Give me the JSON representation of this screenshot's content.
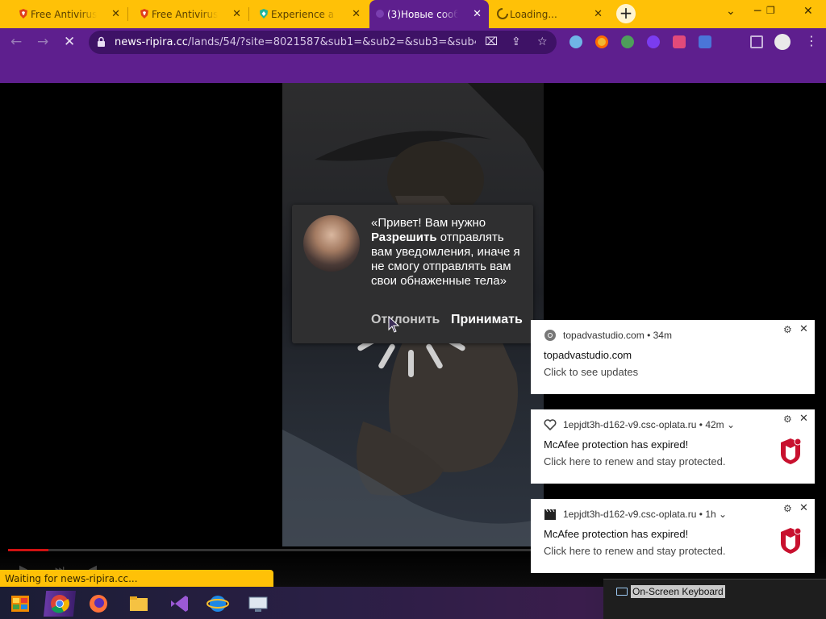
{
  "browser": {
    "tabs": [
      {
        "title": "Free Antivirus",
        "icon": "brave-shield-icon",
        "active": false
      },
      {
        "title": "Free Antivirus",
        "icon": "brave-shield-icon",
        "active": false
      },
      {
        "title": "Experience a c",
        "icon": "green-shield-icon",
        "active": false
      },
      {
        "title": "(3)Новые сооб",
        "icon": "page-icon",
        "active": true
      },
      {
        "title": "Loading...",
        "icon": "loading-spinner-icon",
        "active": false
      }
    ],
    "new_tab_glyph": "+",
    "address": {
      "host": "news-ripira.cc",
      "path": "/lands/54/?site=8021587&sub1=&sub2=&sub3=&sub4="
    },
    "theme_colors": {
      "tab_strip": "#ffc107",
      "toolbar": "#5e1f8e"
    }
  },
  "permission_popup": {
    "message_open": "«Привет! Вам нужно",
    "message_bold": "Разрешить",
    "message_rest": " отправлять вам уведомления, иначе я не смогу отправлять вам свои обнаженные тела»",
    "deny_label": "Отклонить",
    "allow_label": "Принимать"
  },
  "notifications": [
    {
      "source": "topadvastudio.com",
      "age": "34m",
      "title": "topadvastudio.com",
      "body": "Click to see updates",
      "icon": "chrome-icon",
      "logo": false
    },
    {
      "source": "1epjdt3h-d162-v9.csc-oplata.ru",
      "age": "42m",
      "title": "McAfee protection has expired!",
      "body": "Click here to renew and stay protected.",
      "icon": "heart-icon",
      "logo": true
    },
    {
      "source": "1epjdt3h-d162-v9.csc-oplata.ru",
      "age": "1h",
      "title": "McAfee protection has expired!",
      "body": "Click here to renew and stay protected.",
      "icon": "clapperboard-icon",
      "logo": true
    }
  ],
  "status_text": "Waiting for news-ripira.cc...",
  "taskbar": {
    "apps": [
      "start-icon",
      "chrome-icon",
      "firefox-icon",
      "file-explorer-icon",
      "visual-studio-icon",
      "internet-explorer-icon",
      "remote-desktop-icon"
    ],
    "osk_label": "On-Screen Keyboard"
  }
}
